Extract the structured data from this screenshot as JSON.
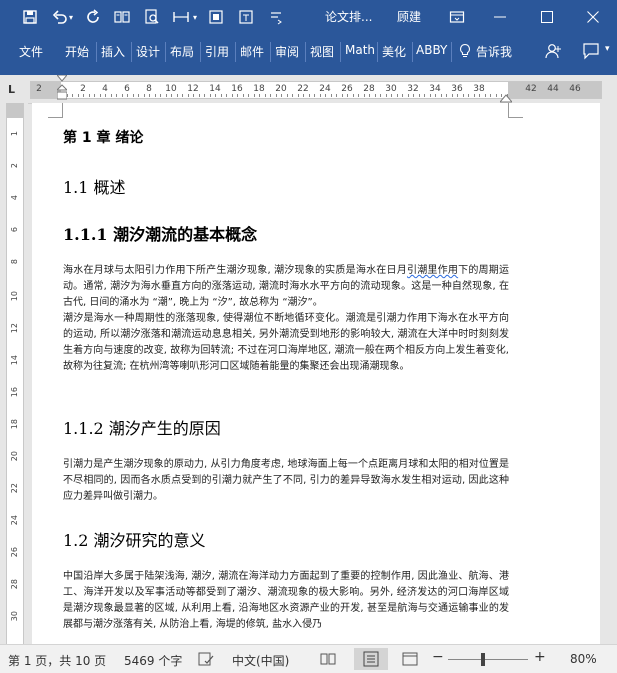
{
  "titlebar": {
    "title": "论文排...",
    "username": "顾建",
    "icons": [
      "save-icon",
      "undo-icon",
      "redo-icon",
      "read-mode-icon",
      "print-preview-icon",
      "spacing-icon",
      "format-icon",
      "more-icon"
    ]
  },
  "ribbon": {
    "tabs": [
      "文件",
      "开始",
      "插入",
      "设计",
      "布局",
      "引用",
      "邮件",
      "审阅",
      "视图",
      "Math",
      "美化",
      "ABBY"
    ],
    "tell_me": "告诉我"
  },
  "ruler": {
    "h_numbers": [
      "2",
      "2",
      "4",
      "6",
      "8",
      "10",
      "12",
      "14",
      "16",
      "18",
      "20",
      "22",
      "24",
      "26",
      "28",
      "30",
      "32",
      "34",
      "36",
      "38",
      "42",
      "44",
      "46"
    ],
    "v_numbers": [
      "1",
      "2",
      "4",
      "6",
      "8",
      "10",
      "12",
      "14",
      "16",
      "18",
      "20",
      "22",
      "24",
      "26",
      "28",
      "30"
    ]
  },
  "doc": {
    "chapter": "第 1 章  绪论",
    "s1": "1.1 概述",
    "s1_1": "1.1.1 潮汐潮流的基本概念",
    "p1a_pre": "海水在月球与太阳引力作用下所产生潮汐现象, 潮汐现象的实质是海水在日月",
    "p1a_wavy": "引潮里作用",
    "p1a_post": "下的周期运动。通常, 潮汐为海水垂直方向的涨落运动, 潮流时海水水平方向的流动现象。这是一种自然现象, 在古代, 日间的涌水为 “潮”, 晚上为 “汐”, 故总称为 “潮汐”。",
    "p1b": "潮汐是海水一种周期性的涨落现象, 使得潮位不断地循环变化。潮流是引潮力作用下海水在水平方向的运动, 所以潮汐涨落和潮流运动息息相关, 另外潮流受到地形的影响较大, 潮流在大洋中时时刻刻发生着方向与速度的改变, 故称为回转流; 不过在河口海岸地区, 潮流一般在两个相反方向上发生着变化, 故称为往复流; 在杭州湾等喇叭形河口区域随着能量的集聚还会出现涌潮现象。",
    "s1_2": "1.1.2 潮汐产生的原因",
    "p2": "引潮力是产生潮汐现象的原动力, 从引力角度考虑, 地球海面上每一个点距离月球和太阳的相对位置是不尽相同的, 因而各水质点受到的引潮力就产生了不同, 引力的差异导致海水发生相对运动, 因此这种应力差异叫做引潮力。",
    "s2": "1.2 潮汐研究的意义",
    "p3": "中国沿岸大多属于陆架浅海, 潮汐, 潮流在海洋动力方面起到了重要的控制作用, 因此渔业、航海、港工、海洋开发以及军事活动等都受到了潮汐、潮流现象的极大影响。另外, 经济发达的河口海岸区域是潮汐现象最显著的区域, 从利用上看, 沿海地区水资源产业的开发, 甚至是航海与交通运输事业的发展都与潮汐涨落有关, 从防治上看, 海堤的修筑, 盐水入侵乃"
  },
  "status": {
    "page": "第 1 页，共 10 页",
    "words": "5469 个字",
    "lang": "中文(中国)",
    "zoom": "80%"
  }
}
